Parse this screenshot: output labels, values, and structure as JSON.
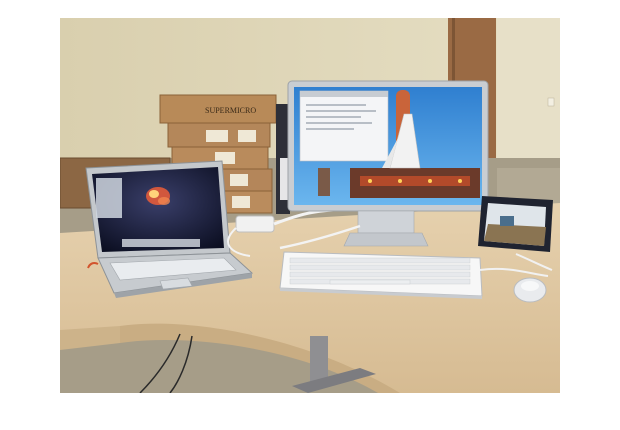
{
  "scene": {
    "carton_brand": "SUPERMICRO",
    "colors": {
      "wall": "#ddd3b4",
      "floor": "#a69d88",
      "desk": "#e0c9a4",
      "monitor_frame": "#c9cdd2",
      "sky": "#3a8fd8"
    }
  }
}
